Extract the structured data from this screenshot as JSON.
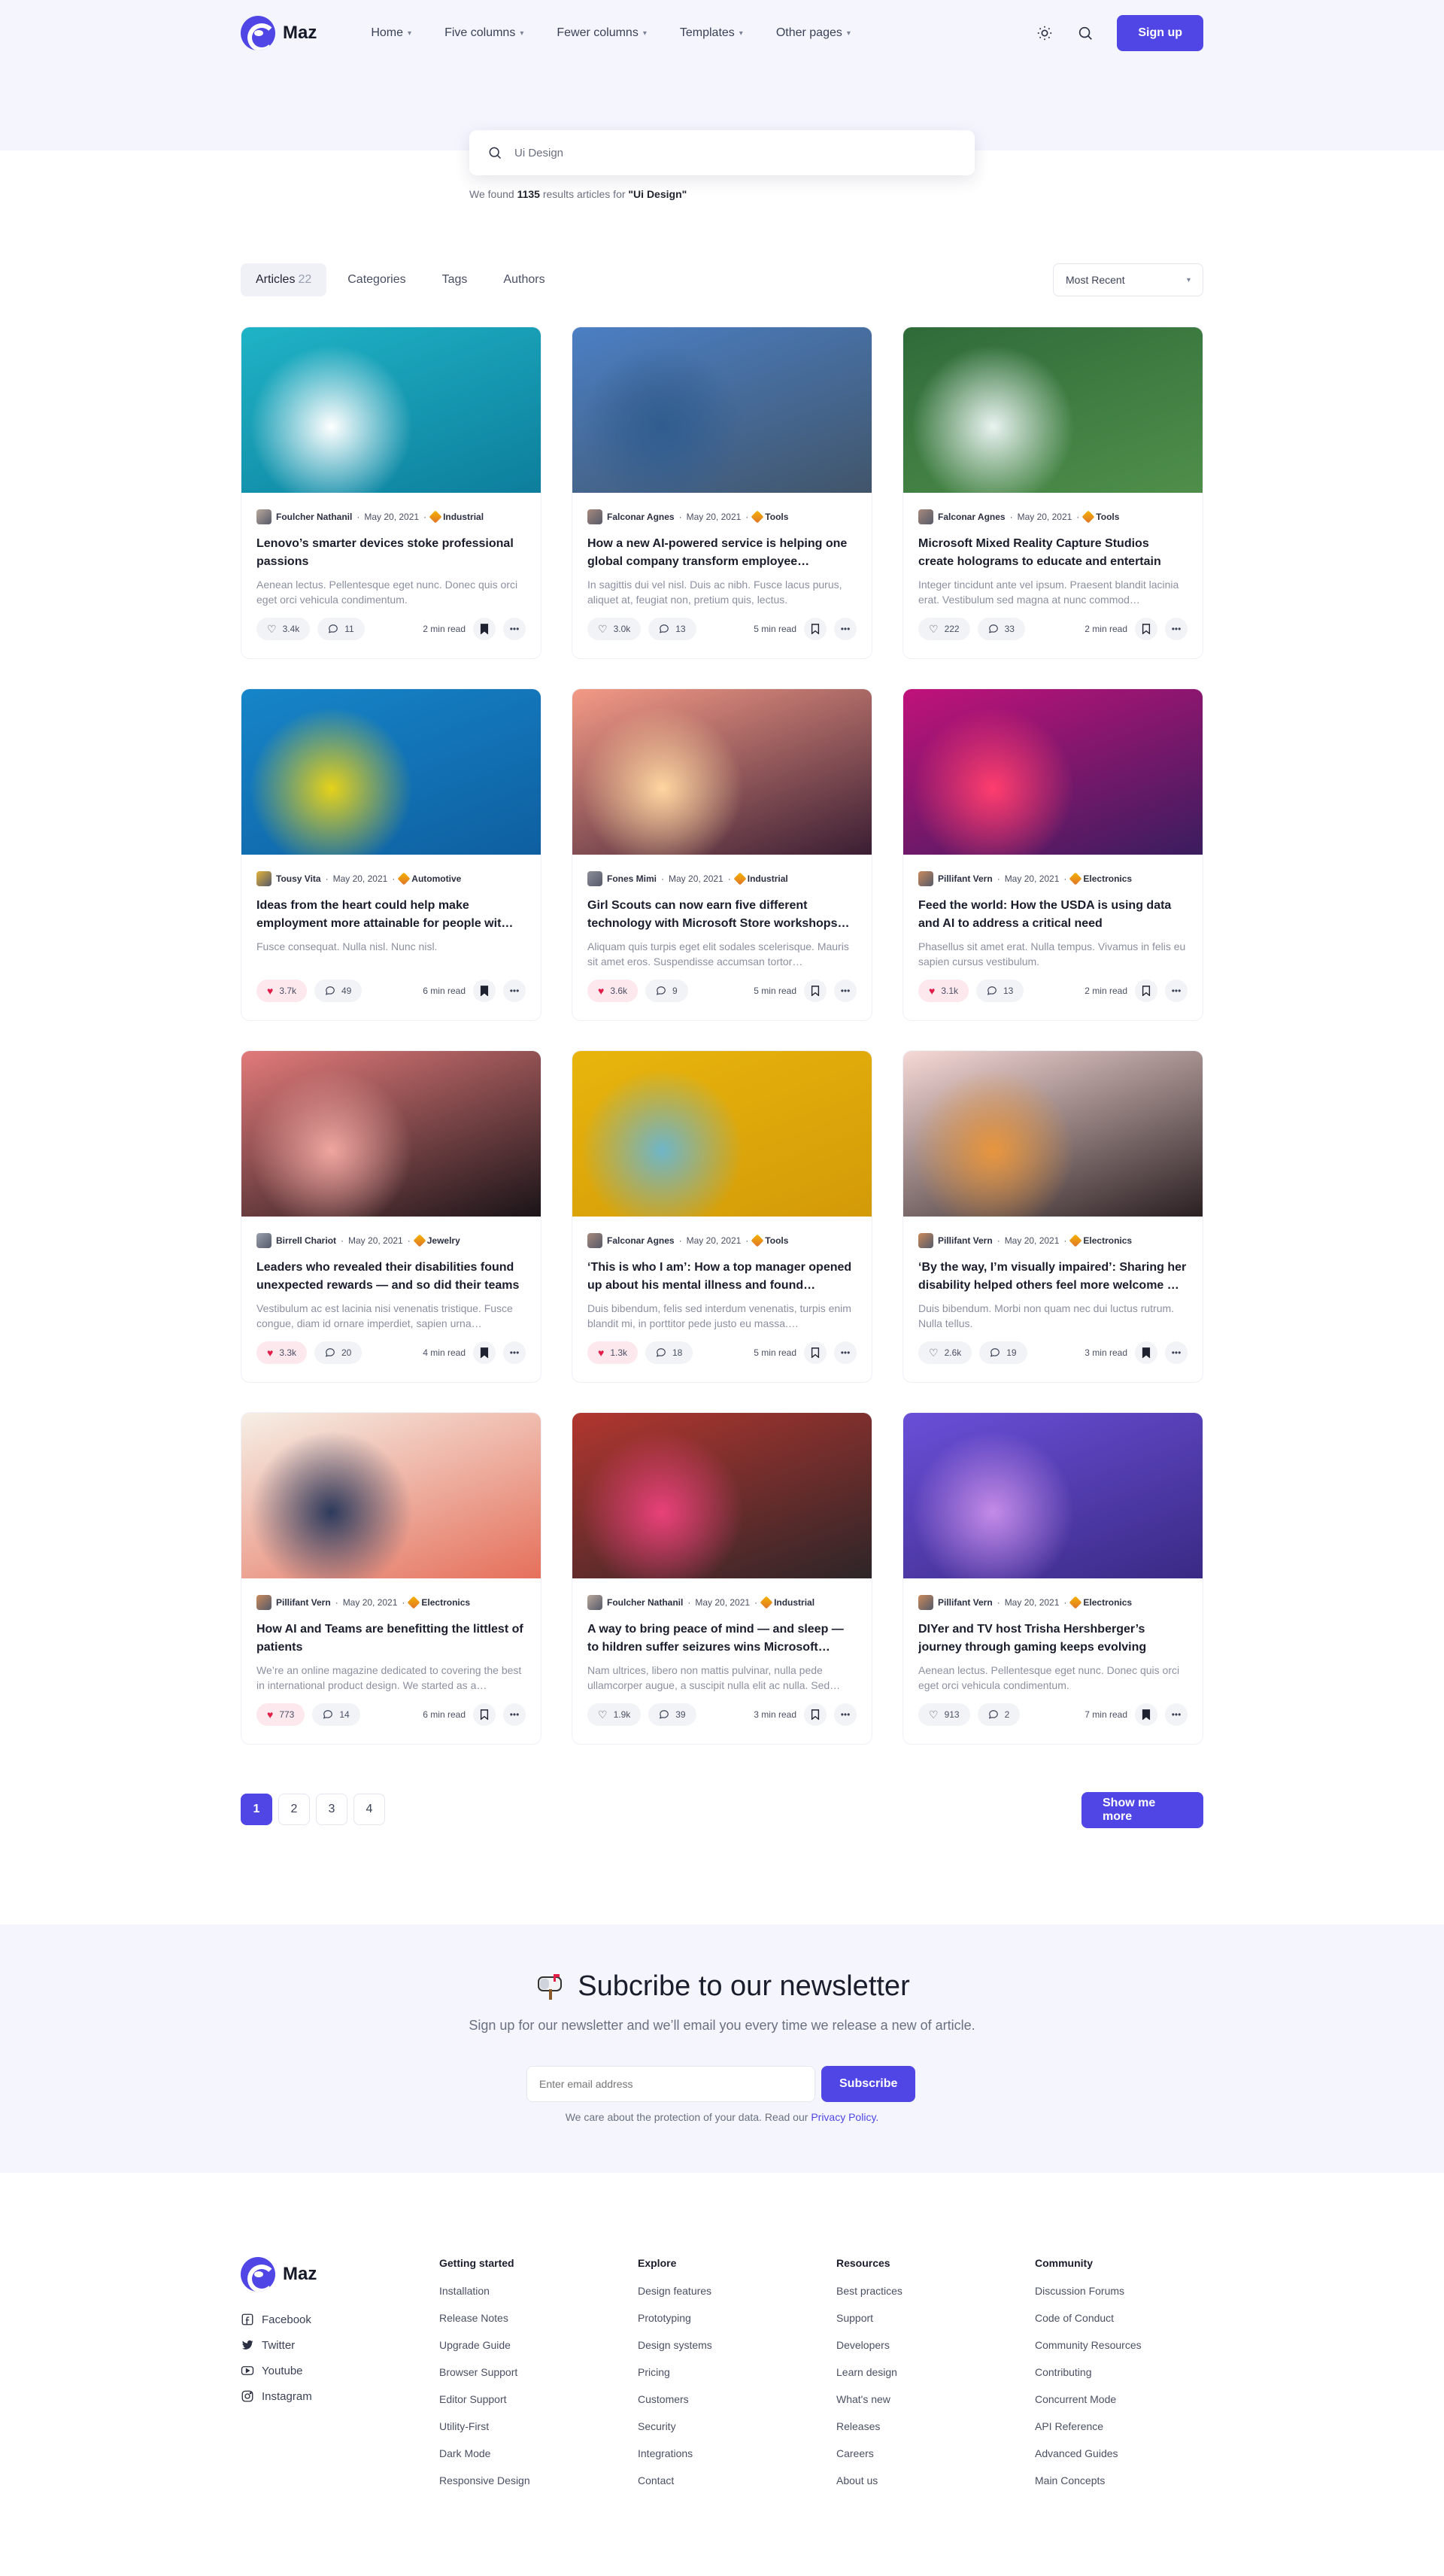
{
  "brand": {
    "name": "Maz"
  },
  "nav": [
    "Home",
    "Five columns",
    "Fewer columns",
    "Templates",
    "Other pages"
  ],
  "header": {
    "signup": "Sign up"
  },
  "search": {
    "value": "Ui Design",
    "found_prefix": "We found",
    "count": "1135",
    "found_middle": "results articles for",
    "query": "\"Ui Design\""
  },
  "tabs": [
    {
      "label": "Articles",
      "count": "22"
    },
    {
      "label": "Categories",
      "count": ""
    },
    {
      "label": "Tags",
      "count": ""
    },
    {
      "label": "Authors",
      "count": ""
    }
  ],
  "sort": {
    "value": "Most Recent"
  },
  "cards": [
    {
      "author": "Foulcher Nathanil",
      "date": "May 20, 2021",
      "category": "Industrial",
      "title": "Lenovo’s smarter devices stoke professional passions",
      "excerpt": "Aenean lectus. Pellentesque eget nunc. Donec quis orci eget orci vehicula condimentum.",
      "likes": "3.4k",
      "comments": "11",
      "read": "2 min read",
      "liked": false,
      "saved": true,
      "img": [
        "#1fb3c6",
        "#0d7e9c",
        "#ffffff"
      ],
      "av": "#b9a89a"
    },
    {
      "author": "Falconar Agnes",
      "date": "May 20, 2021",
      "category": "Tools",
      "title": "How a new AI-powered service is helping one global company transform employee…",
      "excerpt": "In sagittis dui vel nisl. Duis ac nibh. Fusce lacus purus, aliquet at, feugiat non, pretium quis, lectus.",
      "likes": "3.0k",
      "comments": "13",
      "read": "5 min read",
      "liked": false,
      "saved": false,
      "img": [
        "#4b7fc4",
        "#41556a",
        "#2f5c8f"
      ],
      "av": "#a88a7c"
    },
    {
      "author": "Falconar Agnes",
      "date": "May 20, 2021",
      "category": "Tools",
      "title": "Microsoft Mixed Reality Capture Studios create holograms to educate and entertain",
      "excerpt": "Integer tincidunt ante vel ipsum. Praesent blandit lacinia erat. Vestibulum sed magna at nunc commod…",
      "likes": "222",
      "comments": "33",
      "read": "2 min read",
      "liked": false,
      "saved": false,
      "img": [
        "#2f6b3a",
        "#4f8f4a",
        "#e9f3f1"
      ],
      "av": "#a88a7c"
    },
    {
      "author": "Tousy Vita",
      "date": "May 20, 2021",
      "category": "Automotive",
      "title": "Ideas from the heart could help make employment more attainable for people wit…",
      "excerpt": "Fusce consequat. Nulla nisl. Nunc nisl.",
      "likes": "3.7k",
      "comments": "49",
      "read": "6 min read",
      "liked": true,
      "saved": true,
      "img": [
        "#1685c9",
        "#0e5fa0",
        "#e6d21a"
      ],
      "av": "#e3b43a"
    },
    {
      "author": "Fones Mimi",
      "date": "May 20, 2021",
      "category": "Industrial",
      "title": "Girl Scouts can now earn five different technology with Microsoft Store workshops…",
      "excerpt": "Aliquam quis turpis eget elit sodales scelerisque. Mauris sit amet eros. Suspendisse accumsan tortor…",
      "likes": "3.6k",
      "comments": "9",
      "read": "5 min read",
      "liked": true,
      "saved": false,
      "img": [
        "#f49a86",
        "#3a1e33",
        "#ffd6a0"
      ],
      "av": "#8c8f99"
    },
    {
      "author": "Pillifant Vern",
      "date": "May 20, 2021",
      "category": "Electronics",
      "title": "Feed the world: How the USDA is using data and AI to address a critical need",
      "excerpt": "Phasellus sit amet erat. Nulla tempus. Vivamus in felis eu sapien cursus vestibulum.",
      "likes": "3.1k",
      "comments": "13",
      "read": "2 min read",
      "liked": true,
      "saved": false,
      "img": [
        "#c0127a",
        "#3a1d5e",
        "#ff3d6e"
      ],
      "av": "#c98a5a"
    },
    {
      "author": "Birrell Chariot",
      "date": "May 20, 2021",
      "category": "Jewelry",
      "title": "Leaders who revealed their disabilities found unexpected rewards — and so did their teams",
      "excerpt": "Vestibulum ac est lacinia nisi venenatis tristique. Fusce congue, diam id ornare imperdiet, sapien urna…",
      "likes": "3.3k",
      "comments": "20",
      "read": "4 min read",
      "liked": true,
      "saved": true,
      "img": [
        "#e27a7a",
        "#1a1418",
        "#f0a6a0"
      ],
      "av": "#9aa0ad"
    },
    {
      "author": "Falconar Agnes",
      "date": "May 20, 2021",
      "category": "Tools",
      "title": "‘This is who I am’: How a top manager opened up about his mental illness and found…",
      "excerpt": "Duis bibendum, felis sed interdum venenatis, turpis enim blandit mi, in porttitor pede justo eu massa.…",
      "likes": "1.3k",
      "comments": "18",
      "read": "5 min read",
      "liked": true,
      "saved": false,
      "img": [
        "#e8b50c",
        "#d39a08",
        "#6fb6c9"
      ],
      "av": "#a88a7c"
    },
    {
      "author": "Pillifant Vern",
      "date": "May 20, 2021",
      "category": "Electronics",
      "title": "‘By the way, I’m visually impaired’: Sharing her disability helped others feel more welcome …",
      "excerpt": "Duis bibendum. Morbi non quam nec dui luctus rutrum. Nulla tellus.",
      "likes": "2.6k",
      "comments": "19",
      "read": "3 min read",
      "liked": false,
      "saved": true,
      "img": [
        "#f5d9d6",
        "#2b2022",
        "#e8963e"
      ],
      "av": "#c98a5a"
    },
    {
      "author": "Pillifant Vern",
      "date": "May 20, 2021",
      "category": "Electronics",
      "title": "How AI and Teams are benefitting the littlest of patients",
      "excerpt": "We’re an online magazine dedicated to covering the best in international product design. We started as a…",
      "likes": "773",
      "comments": "14",
      "read": "6 min read",
      "liked": true,
      "saved": false,
      "img": [
        "#f6efe6",
        "#e5705b",
        "#2d3a5c"
      ],
      "av": "#c98a5a"
    },
    {
      "author": "Foulcher Nathanil",
      "date": "May 20, 2021",
      "category": "Industrial",
      "title": "A way to bring peace of mind — and sleep — to hildren suffer seizures wins Microsoft…",
      "excerpt": "Nam ultrices, libero non mattis pulvinar, nulla pede ullamcorper augue, a suscipit nulla elit ac nulla. Sed…",
      "likes": "1.9k",
      "comments": "39",
      "read": "3 min read",
      "liked": false,
      "saved": false,
      "img": [
        "#b2362f",
        "#2d2528",
        "#e9417a"
      ],
      "av": "#b9a89a"
    },
    {
      "author": "Pillifant Vern",
      "date": "May 20, 2021",
      "category": "Electronics",
      "title": "DIYer and TV host Trisha Hershberger’s journey through gaming keeps evolving",
      "excerpt": "Aenean lectus. Pellentesque eget nunc. Donec quis orci eget orci vehicula condimentum.",
      "likes": "913",
      "comments": "2",
      "read": "7 min read",
      "liked": false,
      "saved": true,
      "img": [
        "#6a4fd8",
        "#3a2a84",
        "#c48be8"
      ],
      "av": "#c98a5a"
    }
  ],
  "pagination": {
    "pages": [
      "1",
      "2",
      "3",
      "4"
    ],
    "active": "1",
    "more": "Show me more"
  },
  "newsletter": {
    "title": "Subcribe to our newsletter",
    "subtitle": "Sign up for our newsletter and we’ll email you every time we release a new of article.",
    "placeholder": "Enter email address",
    "button": "Subscribe",
    "note": "We care about the protection of your data. Read our",
    "policy": "Privacy Policy."
  },
  "footer": {
    "social": [
      "Facebook",
      "Twitter",
      "Youtube",
      "Instagram"
    ],
    "columns": [
      {
        "title": "Getting started",
        "links": [
          "Installation",
          "Release Notes",
          "Upgrade Guide",
          "Browser Support",
          "Editor Support",
          "Utility-First",
          "Dark Mode",
          "Responsive Design"
        ]
      },
      {
        "title": "Explore",
        "links": [
          "Design features",
          "Prototyping",
          "Design systems",
          "Pricing",
          "Customers",
          "Security",
          "Integrations",
          "Contact"
        ]
      },
      {
        "title": "Resources",
        "links": [
          "Best practices",
          "Support",
          "Developers",
          "Learn design",
          "What's new",
          "Releases",
          "Careers",
          "About us"
        ]
      },
      {
        "title": "Community",
        "links": [
          "Discussion Forums",
          "Code of Conduct",
          "Community Resources",
          "Contributing",
          "Concurrent Mode",
          "API Reference",
          "Advanced Guides",
          "Main Concepts"
        ]
      }
    ]
  },
  "colors": {
    "accent": "#4f46e5",
    "like": "#e11d48",
    "hero_bg": "#f4f5fd"
  }
}
